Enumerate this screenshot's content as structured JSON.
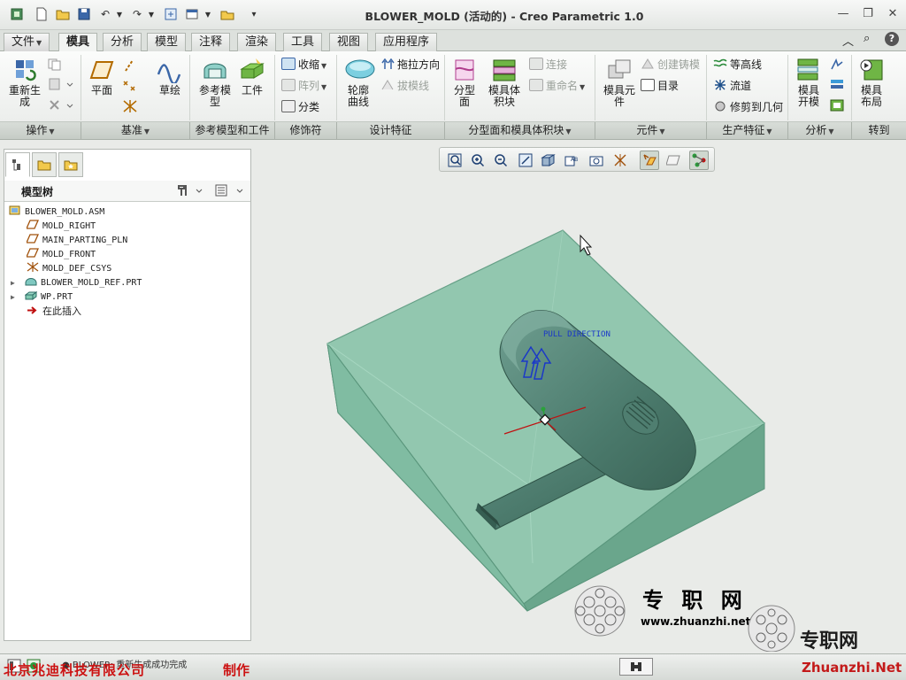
{
  "window": {
    "title": "BLOWER_MOLD (活动的) - Creo Parametric 1.0"
  },
  "tabs": [
    {
      "label": "文件",
      "dropdown": true
    },
    {
      "label": "模具",
      "active": true
    },
    {
      "label": "分析"
    },
    {
      "label": "模型"
    },
    {
      "label": "注释"
    },
    {
      "label": "渲染"
    },
    {
      "label": "工具"
    },
    {
      "label": "视图"
    },
    {
      "label": "应用程序"
    }
  ],
  "ribbon": {
    "regen": "重新生\n成",
    "plane": "平面",
    "sketch": "草绘",
    "ref_model": "参考模\n型",
    "workpiece": "工件",
    "shrink": "收缩",
    "pattern": "阵列",
    "classify": "分类",
    "silhouette": "轮廓\n曲线",
    "drag_dir": "拖拉方向",
    "draft_line": "拔模线",
    "parting_surface": "分型\n面",
    "mold_volume": "模具体\n积块",
    "connect": "连接",
    "rename": "重命名",
    "mold_component": "模具元\n件",
    "create_casting": "创建铸模",
    "catalog": "目录",
    "waterline": "等高线",
    "runner": "流道",
    "trim_to_geom": "修剪到几何",
    "mold_open": "模具\n开模",
    "mold_layout": "模具\n布局"
  },
  "groups": [
    {
      "label": "操作",
      "dropdown": true
    },
    {
      "label": "基准",
      "dropdown": true
    },
    {
      "label": "参考模型和工件",
      "dropdown": false
    },
    {
      "label": "修饰符",
      "dropdown": false
    },
    {
      "label": "设计特征",
      "dropdown": false
    },
    {
      "label": "分型面和模具体积块",
      "dropdown": true
    },
    {
      "label": "元件",
      "dropdown": true
    },
    {
      "label": "生产特征",
      "dropdown": true
    },
    {
      "label": "分析",
      "dropdown": true
    },
    {
      "label": "转到",
      "dropdown": false
    }
  ],
  "model_tree": {
    "title": "模型树",
    "items": [
      {
        "label": "BLOWER_MOLD.ASM",
        "icon": "assembly-icon"
      },
      {
        "label": "MOLD_RIGHT",
        "icon": "datum-plane-icon"
      },
      {
        "label": "MAIN_PARTING_PLN",
        "icon": "datum-plane-icon"
      },
      {
        "label": "MOLD_FRONT",
        "icon": "datum-plane-icon"
      },
      {
        "label": "MOLD_DEF_CSYS",
        "icon": "csys-icon"
      },
      {
        "label": "BLOWER_MOLD_REF.PRT",
        "icon": "ref-part-icon",
        "expandable": true
      },
      {
        "label": "WP.PRT",
        "icon": "workpiece-icon",
        "expandable": true
      },
      {
        "label": "在此插入",
        "icon": "insert-arrow-icon"
      }
    ]
  },
  "graphics": {
    "annotation": "PULL DIRECTION"
  },
  "status": {
    "message": "● BLOWER: 重新生成成功完成",
    "credit": "北京兆迪科技有限公司",
    "credit_suffix": "制作"
  },
  "watermark": {
    "cn": "专 职 网",
    "url": "www.zhuanzhi.net",
    "cn2": "专职网",
    "url2": "Zhuanzhi.Net"
  },
  "colors": {
    "workpiece": "#7fb7a0",
    "part": "#4f7e70",
    "accent_red": "#cc1111"
  }
}
